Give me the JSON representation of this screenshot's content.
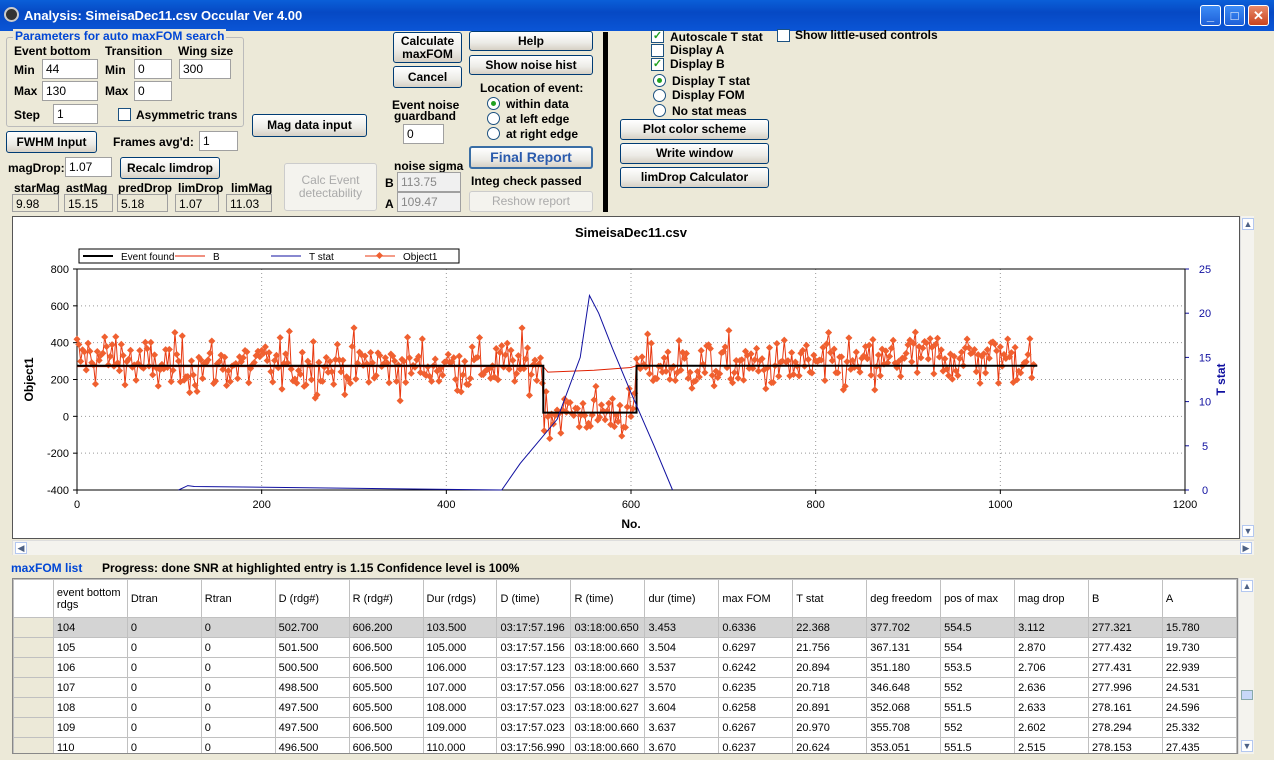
{
  "window": {
    "title": "Analysis: SimeisaDec11.csv  Occular Ver 4.00",
    "min": "_",
    "max": "□",
    "close": "✕"
  },
  "params": {
    "group_title": "Parameters for auto maxFOM search",
    "event_bottom": "Event bottom",
    "transition": "Transition",
    "wing_size": "Wing size",
    "min": "Min",
    "max": "Max",
    "step": "Step",
    "eb_min": "44",
    "eb_max": "130",
    "step_val": "1",
    "tr_min": "0",
    "tr_max": "0",
    "wing_val": "300",
    "asym": "Asymmetric trans"
  },
  "buttons": {
    "fwhm": "FWHM Input",
    "mag_data": "Mag data input",
    "recalc": "Recalc limdrop",
    "calc_event": "Calc Event detectability",
    "calc_maxfom": "Calculate maxFOM",
    "cancel": "Cancel",
    "help": "Help",
    "noise_hist": "Show noise hist",
    "final_report": "Final Report",
    "reshow": "Reshow report",
    "plot_color": "Plot color scheme",
    "write_window": "Write window",
    "limdrop_calc": "limDrop Calculator"
  },
  "frames": {
    "label": "Frames avg'd:",
    "value": "1"
  },
  "magdrop": {
    "label": "magDrop:",
    "value": "1.07"
  },
  "stats": {
    "labels": [
      "starMag",
      "astMag",
      "predDrop",
      "limDrop",
      "limMag"
    ],
    "values": [
      "9.98",
      "15.15",
      "5.18",
      "1.07",
      "11.03"
    ]
  },
  "guard": {
    "label1": "Event noise",
    "label2": "guardband",
    "value": "0"
  },
  "noise": {
    "label": "noise sigma",
    "b_label": "B",
    "b_val": "113.75",
    "a_label": "A",
    "a_val": "109.47"
  },
  "location": {
    "title": "Location of event:",
    "options": [
      "within data",
      "at left edge",
      "at right edge"
    ],
    "selected": 0
  },
  "integ": "Integ check passed",
  "display": {
    "checks": [
      {
        "label": "Autoscale T stat",
        "checked": true
      },
      {
        "label": "Display A",
        "checked": false
      },
      {
        "label": "Display B",
        "checked": true
      }
    ],
    "radios": [
      {
        "label": "Display T stat",
        "selected": true
      },
      {
        "label": "Display FOM",
        "selected": false
      },
      {
        "label": "No stat meas",
        "selected": false
      }
    ],
    "little_used": "Show little-used controls"
  },
  "chart_data": {
    "type": "line",
    "title": "SimeisaDec11.csv",
    "xlabel": "No.",
    "ylabel": "Object1",
    "y2label": "T stat",
    "xlim": [
      0,
      1200
    ],
    "ylim": [
      -400,
      800
    ],
    "y2lim": [
      0,
      25
    ],
    "xticks": [
      0,
      200,
      400,
      600,
      800,
      1000,
      1200
    ],
    "yticks": [
      -400,
      -200,
      0,
      200,
      400,
      600,
      800
    ],
    "y2ticks": [
      0,
      5,
      10,
      15,
      20,
      25
    ],
    "legend": [
      "Event found",
      "B",
      "T stat",
      "Object1"
    ],
    "legend_position": "top-left",
    "grid": true,
    "event_found": {
      "x": [
        0,
        505,
        505,
        606,
        606,
        1040
      ],
      "y": [
        275,
        275,
        20,
        20,
        275,
        275
      ]
    },
    "tstat": {
      "x": [
        110,
        120,
        127,
        460,
        480,
        520,
        545,
        555,
        565,
        580,
        600,
        625,
        645
      ],
      "y": [
        0,
        0.5,
        0.4,
        0,
        3,
        8,
        15,
        22,
        20,
        16,
        11,
        5,
        0
      ]
    },
    "colors": {
      "event": "#000000",
      "b": "#E02000",
      "tstat": "#1010A0",
      "object1": "#E83810",
      "marker": "#F06030"
    }
  },
  "list": {
    "title": "maxFOM list",
    "progress": "Progress: done  SNR at highlighted entry is 1.15   Confidence level is  100%",
    "headers": [
      "event bottom rdgs",
      "Dtran",
      "Rtran",
      "D (rdg#)",
      "R (rdg#)",
      "Dur (rdgs)",
      "D (time)",
      "R (time)",
      "dur (time)",
      "max FOM",
      "T stat",
      "deg freedom",
      "pos of max",
      "mag drop",
      "B",
      "A"
    ],
    "rows": [
      [
        "104",
        "0",
        "0",
        "502.700",
        "606.200",
        "103.500",
        "03:17:57.196",
        "03:18:00.650",
        "3.453",
        "0.6336",
        "22.368",
        "377.702",
        "554.5",
        "3.112",
        "277.321",
        "15.780"
      ],
      [
        "105",
        "0",
        "0",
        "501.500",
        "606.500",
        "105.000",
        "03:17:57.156",
        "03:18:00.660",
        "3.504",
        "0.6297",
        "21.756",
        "367.131",
        "554",
        "2.870",
        "277.432",
        "19.730"
      ],
      [
        "106",
        "0",
        "0",
        "500.500",
        "606.500",
        "106.000",
        "03:17:57.123",
        "03:18:00.660",
        "3.537",
        "0.6242",
        "20.894",
        "351.180",
        "553.5",
        "2.706",
        "277.431",
        "22.939"
      ],
      [
        "107",
        "0",
        "0",
        "498.500",
        "605.500",
        "107.000",
        "03:17:57.056",
        "03:18:00.627",
        "3.570",
        "0.6235",
        "20.718",
        "346.648",
        "552",
        "2.636",
        "277.996",
        "24.531"
      ],
      [
        "108",
        "0",
        "0",
        "497.500",
        "605.500",
        "108.000",
        "03:17:57.023",
        "03:18:00.627",
        "3.604",
        "0.6258",
        "20.891",
        "352.068",
        "551.5",
        "2.633",
        "278.161",
        "24.596"
      ],
      [
        "109",
        "0",
        "0",
        "497.500",
        "606.500",
        "109.000",
        "03:17:57.023",
        "03:18:00.660",
        "3.637",
        "0.6267",
        "20.970",
        "355.708",
        "552",
        "2.602",
        "278.294",
        "25.332"
      ],
      [
        "110",
        "0",
        "0",
        "496.500",
        "606.500",
        "110.000",
        "03:17:56.990",
        "03:18:00.660",
        "3.670",
        "0.6237",
        "20.624",
        "353.051",
        "551.5",
        "2.515",
        "278.153",
        "27.435"
      ]
    ],
    "selected_row": 0
  }
}
